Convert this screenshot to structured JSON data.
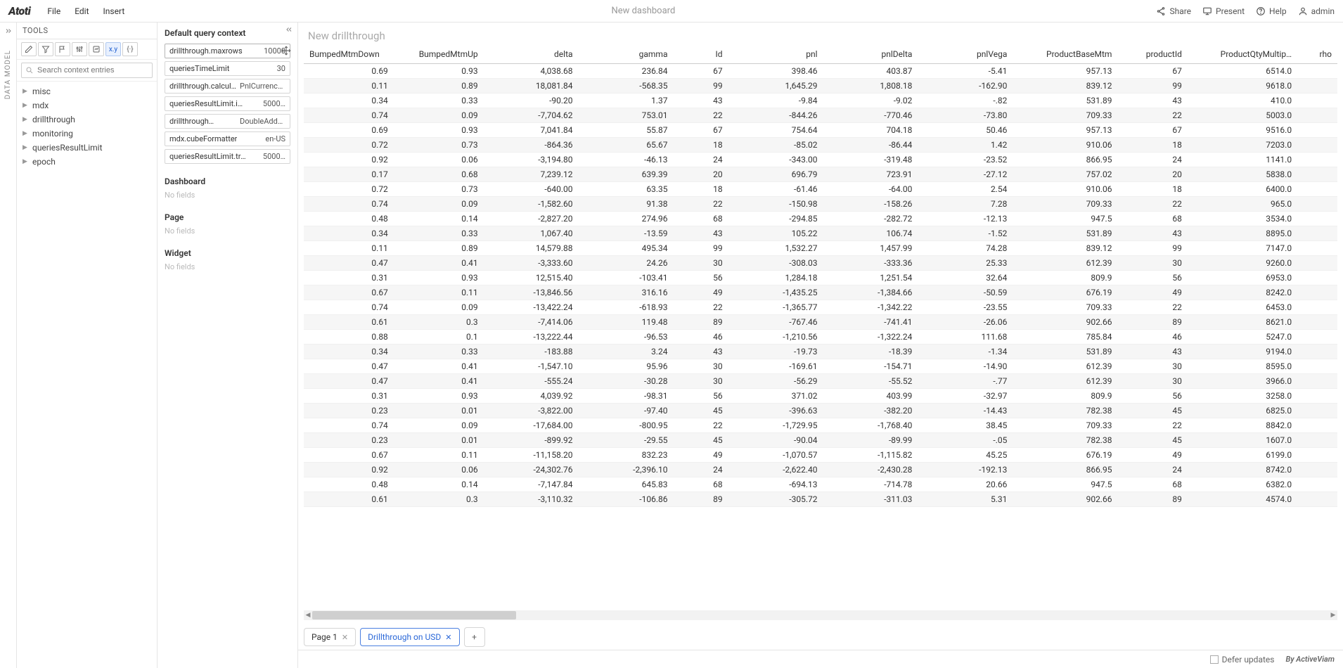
{
  "menubar": {
    "logo": "Atoti",
    "items": [
      "File",
      "Edit",
      "Insert"
    ],
    "title": "New dashboard",
    "right": {
      "share": "Share",
      "present": "Present",
      "help": "Help",
      "user": "admin"
    }
  },
  "rail": {
    "label": "DATA MODEL"
  },
  "tools": {
    "header": "TOOLS",
    "search_placeholder": "Search context entries",
    "tree": [
      "misc",
      "mdx",
      "drillthrough",
      "monitoring",
      "queriesResultLimit",
      "epoch"
    ]
  },
  "context": {
    "heading": "Default query context",
    "rows": [
      {
        "k": "drillthrough.maxrows",
        "v": "10000"
      },
      {
        "k": "queriesTimeLimit",
        "v": "30"
      },
      {
        "k": "drillthrough.calcul…",
        "v": "PnlCurrency…"
      },
      {
        "k": "queriesResultLimit.interm…",
        "v": "5000…"
      },
      {
        "k": "drillthrough…",
        "v": "DoubleAdder,Boo…"
      },
      {
        "k": "mdx.cubeFormatter",
        "v": "en-US"
      },
      {
        "k": "queriesResultLimit.transi…",
        "v": "5000…"
      }
    ],
    "dashboard_label": "Dashboard",
    "page_label": "Page",
    "widget_label": "Widget",
    "no_fields": "No fields"
  },
  "drill": {
    "title": "New drillthrough",
    "columns": [
      "BumpedMtmDown",
      "BumpedMtmUp",
      "delta",
      "gamma",
      "Id",
      "pnl",
      "pnlDelta",
      "pnlVega",
      "ProductBaseMtm",
      "productId",
      "ProductQtyMultip…",
      "rho"
    ],
    "rows": [
      [
        "0.69",
        "0.93",
        "4,038.68",
        "236.84",
        "67",
        "398.46",
        "403.87",
        "-5.41",
        "957.13",
        "67",
        "6514.0",
        ""
      ],
      [
        "0.11",
        "0.89",
        "18,081.84",
        "-568.35",
        "99",
        "1,645.29",
        "1,808.18",
        "-162.90",
        "839.12",
        "99",
        "9618.0",
        ""
      ],
      [
        "0.34",
        "0.33",
        "-90.20",
        "1.37",
        "43",
        "-9.84",
        "-9.02",
        "-.82",
        "531.89",
        "43",
        "410.0",
        ""
      ],
      [
        "0.74",
        "0.09",
        "-7,704.62",
        "753.01",
        "22",
        "-844.26",
        "-770.46",
        "-73.80",
        "709.33",
        "22",
        "5003.0",
        ""
      ],
      [
        "0.69",
        "0.93",
        "7,041.84",
        "55.87",
        "67",
        "754.64",
        "704.18",
        "50.46",
        "957.13",
        "67",
        "9516.0",
        ""
      ],
      [
        "0.72",
        "0.73",
        "-864.36",
        "65.67",
        "18",
        "-85.02",
        "-86.44",
        "1.42",
        "910.06",
        "18",
        "7203.0",
        ""
      ],
      [
        "0.92",
        "0.06",
        "-3,194.80",
        "-46.13",
        "24",
        "-343.00",
        "-319.48",
        "-23.52",
        "866.95",
        "24",
        "1141.0",
        ""
      ],
      [
        "0.17",
        "0.68",
        "7,239.12",
        "639.39",
        "20",
        "696.79",
        "723.91",
        "-27.12",
        "757.02",
        "20",
        "5838.0",
        ""
      ],
      [
        "0.72",
        "0.73",
        "-640.00",
        "63.35",
        "18",
        "-61.46",
        "-64.00",
        "2.54",
        "910.06",
        "18",
        "6400.0",
        ""
      ],
      [
        "0.74",
        "0.09",
        "-1,582.60",
        "91.38",
        "22",
        "-150.98",
        "-158.26",
        "7.28",
        "709.33",
        "22",
        "965.0",
        ""
      ],
      [
        "0.48",
        "0.14",
        "-2,827.20",
        "274.96",
        "68",
        "-294.85",
        "-282.72",
        "-12.13",
        "947.5",
        "68",
        "3534.0",
        ""
      ],
      [
        "0.34",
        "0.33",
        "1,067.40",
        "-13.59",
        "43",
        "105.22",
        "106.74",
        "-1.52",
        "531.89",
        "43",
        "8895.0",
        ""
      ],
      [
        "0.11",
        "0.89",
        "14,579.88",
        "495.34",
        "99",
        "1,532.27",
        "1,457.99",
        "74.28",
        "839.12",
        "99",
        "7147.0",
        ""
      ],
      [
        "0.47",
        "0.41",
        "-3,333.60",
        "24.26",
        "30",
        "-308.03",
        "-333.36",
        "25.33",
        "612.39",
        "30",
        "9260.0",
        ""
      ],
      [
        "0.31",
        "0.93",
        "12,515.40",
        "-103.41",
        "56",
        "1,284.18",
        "1,251.54",
        "32.64",
        "809.9",
        "56",
        "6953.0",
        ""
      ],
      [
        "0.67",
        "0.11",
        "-13,846.56",
        "316.16",
        "49",
        "-1,435.25",
        "-1,384.66",
        "-50.59",
        "676.19",
        "49",
        "8242.0",
        ""
      ],
      [
        "0.74",
        "0.09",
        "-13,422.24",
        "-618.93",
        "22",
        "-1,365.77",
        "-1,342.22",
        "-23.55",
        "709.33",
        "22",
        "6453.0",
        ""
      ],
      [
        "0.61",
        "0.3",
        "-7,414.06",
        "119.48",
        "89",
        "-767.46",
        "-741.41",
        "-26.06",
        "902.66",
        "89",
        "8621.0",
        ""
      ],
      [
        "0.88",
        "0.1",
        "-13,222.44",
        "-96.53",
        "46",
        "-1,210.56",
        "-1,322.24",
        "111.68",
        "785.84",
        "46",
        "5247.0",
        ""
      ],
      [
        "0.34",
        "0.33",
        "-183.88",
        "3.24",
        "43",
        "-19.73",
        "-18.39",
        "-1.34",
        "531.89",
        "43",
        "9194.0",
        ""
      ],
      [
        "0.47",
        "0.41",
        "-1,547.10",
        "95.96",
        "30",
        "-169.61",
        "-154.71",
        "-14.90",
        "612.39",
        "30",
        "8595.0",
        ""
      ],
      [
        "0.47",
        "0.41",
        "-555.24",
        "-30.28",
        "30",
        "-56.29",
        "-55.52",
        "-.77",
        "612.39",
        "30",
        "3966.0",
        ""
      ],
      [
        "0.31",
        "0.93",
        "4,039.92",
        "-98.31",
        "56",
        "371.02",
        "403.99",
        "-32.97",
        "809.9",
        "56",
        "3258.0",
        ""
      ],
      [
        "0.23",
        "0.01",
        "-3,822.00",
        "-97.40",
        "45",
        "-396.63",
        "-382.20",
        "-14.43",
        "782.38",
        "45",
        "6825.0",
        ""
      ],
      [
        "0.74",
        "0.09",
        "-17,684.00",
        "-800.95",
        "22",
        "-1,729.95",
        "-1,768.40",
        "38.45",
        "709.33",
        "22",
        "8842.0",
        ""
      ],
      [
        "0.23",
        "0.01",
        "-899.92",
        "-29.55",
        "45",
        "-90.04",
        "-89.99",
        "-.05",
        "782.38",
        "45",
        "1607.0",
        ""
      ],
      [
        "0.67",
        "0.11",
        "-11,158.20",
        "832.23",
        "49",
        "-1,070.57",
        "-1,115.82",
        "45.25",
        "676.19",
        "49",
        "6199.0",
        ""
      ],
      [
        "0.92",
        "0.06",
        "-24,302.76",
        "-2,396.10",
        "24",
        "-2,622.40",
        "-2,430.28",
        "-192.13",
        "866.95",
        "24",
        "8742.0",
        ""
      ],
      [
        "0.48",
        "0.14",
        "-7,147.84",
        "645.83",
        "68",
        "-694.13",
        "-714.78",
        "20.66",
        "947.5",
        "68",
        "6382.0",
        ""
      ],
      [
        "0.61",
        "0.3",
        "-3,110.32",
        "-106.86",
        "89",
        "-305.72",
        "-311.03",
        "5.31",
        "902.66",
        "89",
        "4574.0",
        ""
      ]
    ]
  },
  "tabs": {
    "page1": "Page 1",
    "active": "Drillthrough on USD"
  },
  "footer": {
    "defer": "Defer updates",
    "by": "By ActiveViam"
  }
}
